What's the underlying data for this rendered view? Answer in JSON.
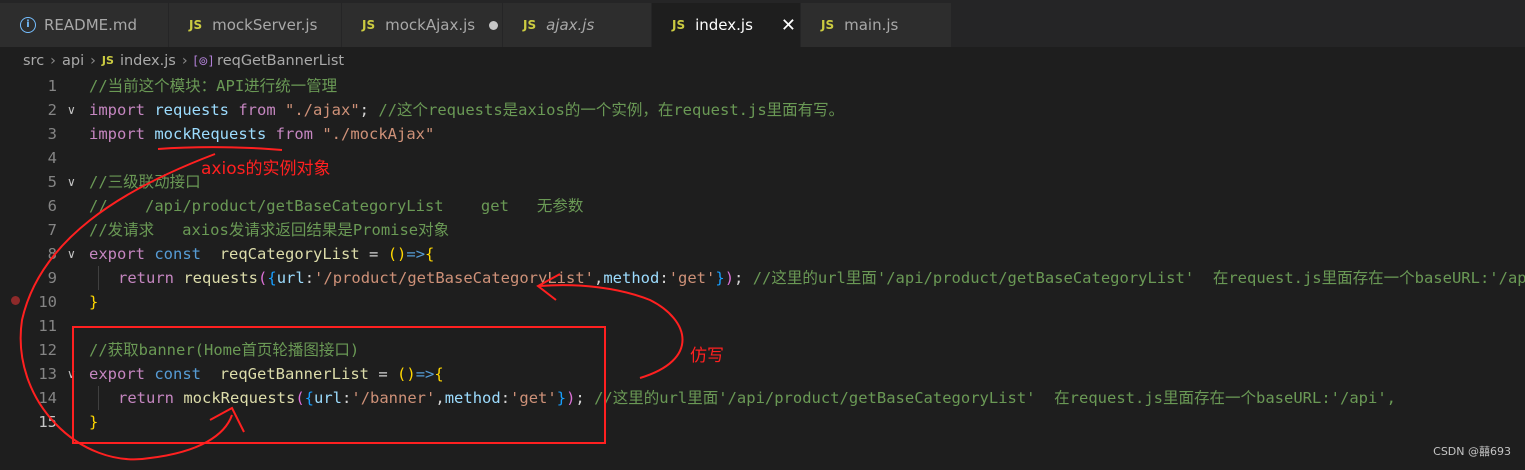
{
  "tabs": [
    {
      "label": "README.md",
      "icon": "info-icon"
    },
    {
      "label": "mockServer.js",
      "icon": "JS"
    },
    {
      "label": "mockAjax.js",
      "icon": "JS",
      "modified": true
    },
    {
      "label": "ajax.js",
      "icon": "JS",
      "italic": true
    },
    {
      "label": "index.js",
      "icon": "JS",
      "active": true
    },
    {
      "label": "main.js",
      "icon": "JS"
    }
  ],
  "breadcrumb": {
    "src": "src",
    "api": "api",
    "file": "index.js",
    "file_icon": "JS",
    "symbol": "reqGetBannerList"
  },
  "gutter": [
    "1",
    "2",
    "3",
    "4",
    "5",
    "6",
    "7",
    "8",
    "9",
    "10",
    "11",
    "12",
    "13",
    "14",
    "15"
  ],
  "code": {
    "l1": "//当前这个模块：API进行统一管理",
    "l2_import": "import",
    "l2_var": "requests",
    "l2_from": "from",
    "l2_str": "\"./ajax\"",
    "l2_semi": ";",
    "l2_comment": "//这个requests是axios的一个实例，在request.js里面有写。",
    "l3_import": "import",
    "l3_var": "mockRequests",
    "l3_from": "from",
    "l3_str": "\"./mockAjax\"",
    "l5": "//三级联动接口",
    "l6": "//    /api/product/getBaseCategoryList    get   无参数",
    "l7": "//发请求   axios发请求返回结果是Promise对象",
    "l8_export": "export",
    "l8_const": "const",
    "l8_name": "reqCategoryList",
    "l8_eq": "=",
    "l8_paren": "()",
    "l8_arrow": "=>",
    "l8_brace": "{",
    "l9_return": "return",
    "l9_fn": "requests",
    "l9_url_key": "url",
    "l9_url_val": "'/product/getBaseCategoryList'",
    "l9_method_key": "method",
    "l9_method_val": "'get'",
    "l9_comment": "//这里的url里面'/api/product/getBaseCategoryList'  在request.js里面存在一个baseURL:'/api',",
    "l10": "}",
    "l12": "//获取banner(Home首页轮播图接口)",
    "l13_export": "export",
    "l13_const": "const",
    "l13_name": "reqGetBannerList",
    "l13_eq": "=",
    "l13_paren": "()",
    "l13_arrow": "=>",
    "l13_brace": "{",
    "l14_return": "return",
    "l14_fn": "mockRequests",
    "l14_url_key": "url",
    "l14_url_val": "'/banner'",
    "l14_method_key": "method",
    "l14_method_val": "'get'",
    "l14_comment": "//这里的url里面'/api/product/getBaseCategoryList'  在request.js里面存在一个baseURL:'/api',",
    "l15": "}"
  },
  "annotations": {
    "axios_instance": "axios的实例对象",
    "imitate": "仿写"
  },
  "watermark": "CSDN @囍693",
  "colors": {
    "background": "#1e1e1e",
    "comment": "#6a9955",
    "keyword": "#569cd6",
    "string": "#ce9178",
    "variable": "#9cdcfe",
    "function": "#dcdcaa",
    "annotation": "#ff2020"
  }
}
